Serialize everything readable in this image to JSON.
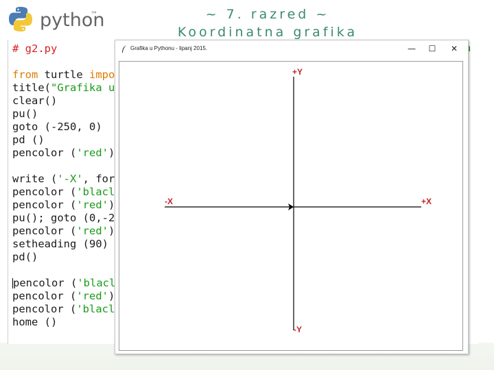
{
  "logo": {
    "wordmark": "python",
    "tm": "™"
  },
  "slide_title": {
    "line1": "~ 7. razred ~",
    "line2": "Koordinatna grafika"
  },
  "editor": {
    "lines": [
      {
        "parts": [
          {
            "t": "# g2.py",
            "c": "cm"
          }
        ]
      },
      {
        "parts": [
          {
            "t": "",
            "c": ""
          }
        ]
      },
      {
        "parts": [
          {
            "t": "from",
            "c": "kw"
          },
          {
            "t": " turtle ",
            "c": ""
          },
          {
            "t": "impo",
            "c": "kw"
          }
        ]
      },
      {
        "parts": [
          {
            "t": "title(",
            "c": ""
          },
          {
            "t": "\"Grafika u",
            "c": "str"
          }
        ]
      },
      {
        "parts": [
          {
            "t": "clear()",
            "c": ""
          }
        ]
      },
      {
        "parts": [
          {
            "t": "pu()",
            "c": ""
          }
        ]
      },
      {
        "parts": [
          {
            "t": "goto (-250, 0)",
            "c": ""
          }
        ]
      },
      {
        "parts": [
          {
            "t": "pd ()",
            "c": ""
          }
        ]
      },
      {
        "parts": [
          {
            "t": "pencolor (",
            "c": ""
          },
          {
            "t": "'red'",
            "c": "str"
          },
          {
            "t": ")",
            "c": ""
          }
        ]
      },
      {
        "parts": [
          {
            "t": "",
            "c": ""
          }
        ]
      },
      {
        "parts": [
          {
            "t": "write (",
            "c": ""
          },
          {
            "t": "'-X'",
            "c": "str"
          },
          {
            "t": ", for",
            "c": ""
          }
        ]
      },
      {
        "parts": [
          {
            "t": "pencolor (",
            "c": ""
          },
          {
            "t": "'blacl",
            "c": "str"
          }
        ]
      },
      {
        "parts": [
          {
            "t": "pencolor (",
            "c": ""
          },
          {
            "t": "'red'",
            "c": "str"
          },
          {
            "t": ")",
            "c": ""
          }
        ]
      },
      {
        "parts": [
          {
            "t": "pu(); goto (0,-2",
            "c": ""
          }
        ]
      },
      {
        "parts": [
          {
            "t": "pencolor (",
            "c": ""
          },
          {
            "t": "'red'",
            "c": "str"
          },
          {
            "t": ")",
            "c": ""
          }
        ]
      },
      {
        "parts": [
          {
            "t": "setheading (90)",
            "c": ""
          }
        ]
      },
      {
        "parts": [
          {
            "t": "pd()",
            "c": ""
          }
        ]
      },
      {
        "parts": [
          {
            "t": "",
            "c": ""
          }
        ]
      },
      {
        "parts": [
          {
            "t": "pencolor (",
            "c": ""
          },
          {
            "t": "'blacl",
            "c": "str"
          }
        ],
        "caret": true
      },
      {
        "parts": [
          {
            "t": "pencolor (",
            "c": ""
          },
          {
            "t": "'red'",
            "c": "str"
          },
          {
            "t": ")",
            "c": ""
          }
        ]
      },
      {
        "parts": [
          {
            "t": "pencolor (",
            "c": ""
          },
          {
            "t": "'blacl",
            "c": "str"
          }
        ]
      },
      {
        "parts": [
          {
            "t": "home ()",
            "c": ""
          }
        ]
      }
    ],
    "right_fragment": "a"
  },
  "turtle_window": {
    "title": "Grafika u Pythonu - lipanj 2015.",
    "minimize": "—",
    "maximize": "☐",
    "close": "✕",
    "axis_labels": {
      "plus_y": "+Y",
      "minus_y": "-Y",
      "minus_x": "-X",
      "plus_x": "+X"
    },
    "colors": {
      "axis_line": "#000000",
      "label": "#c0252b"
    }
  }
}
